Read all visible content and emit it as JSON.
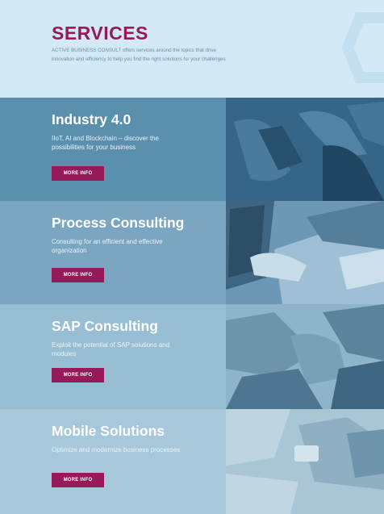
{
  "header": {
    "title": "SERVICES",
    "intro": "ACTIVE BUSINESS CONSULT offers services around the topics that drive innovation and efficiency to help you find the right solutions for your challenges"
  },
  "services": [
    {
      "title": "Industry 4.0",
      "description": "IIoT, AI and Blockchain – discover the possibilities for your business",
      "button": "MORE INFO"
    },
    {
      "title": "Process Consulting",
      "description": "Consulting for an efficient and effective organization",
      "button": "MORE INFO"
    },
    {
      "title": "SAP Consulting",
      "description": "Exploit the potential of SAP solutions and modules",
      "button": "MORE INFO"
    },
    {
      "title": "Mobile Solutions",
      "description": "Optimize and modernize business processes",
      "button": "MORE INFO"
    }
  ],
  "colors": {
    "accent": "#96195a",
    "header_bg": "#d3e9f6",
    "row_bgs": [
      "#5b8fae",
      "#7aa6c1",
      "#98bed4",
      "#a7c8db"
    ]
  }
}
